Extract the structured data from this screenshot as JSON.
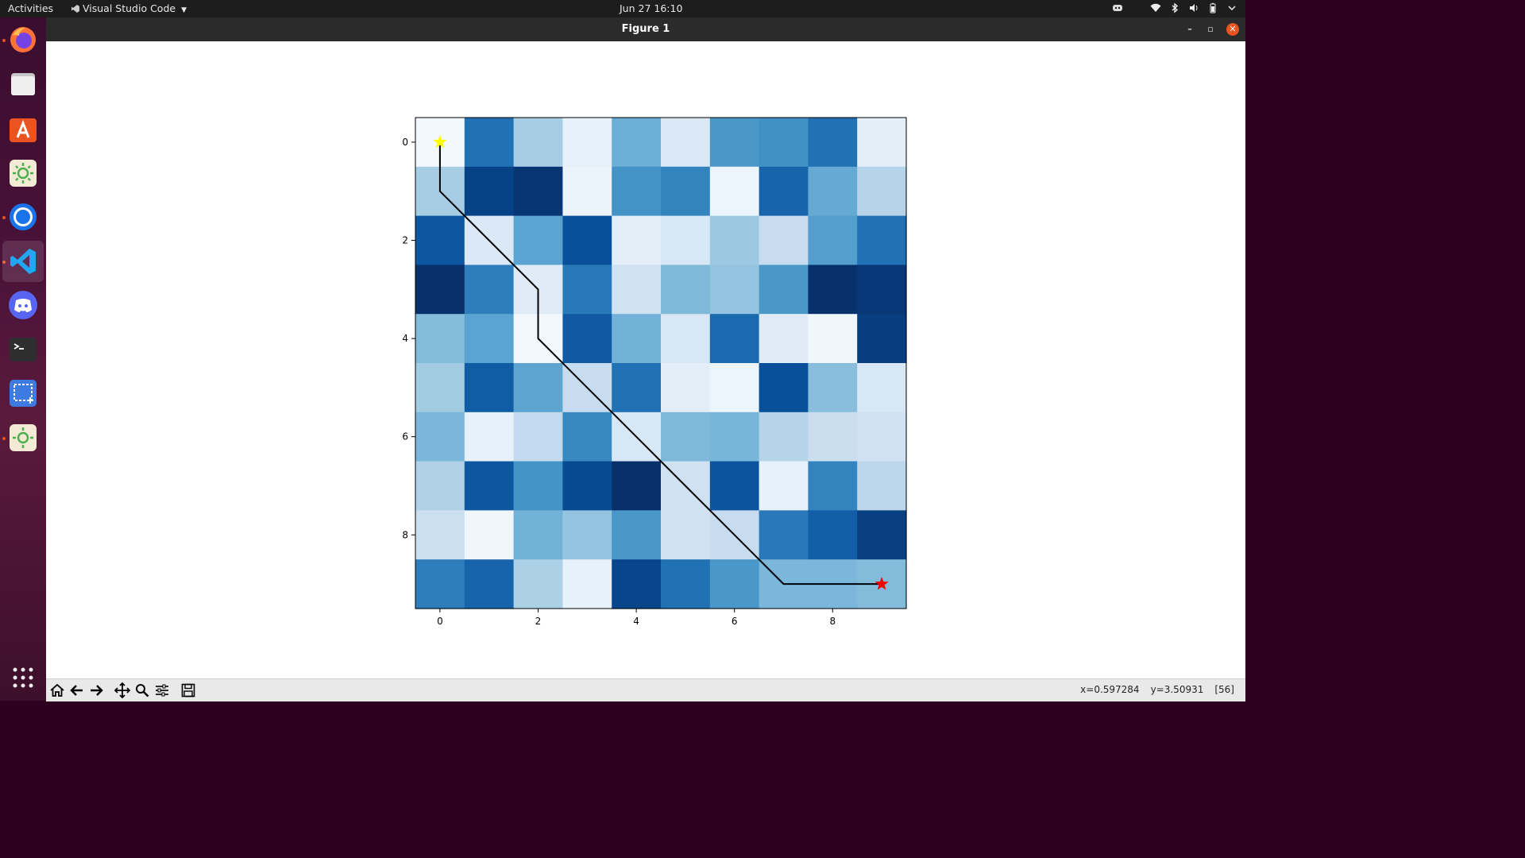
{
  "topbar": {
    "activities": "Activities",
    "app_name": "Visual Studio Code",
    "clock": "Jun 27  16:10"
  },
  "dock": {
    "items": [
      {
        "name": "firefox",
        "icon": "firefox-icon",
        "running": true
      },
      {
        "name": "files",
        "icon": "folder-icon",
        "running": false
      },
      {
        "name": "software",
        "icon": "app-store-icon",
        "running": false
      },
      {
        "name": "settings",
        "icon": "sun-settings-icon",
        "running": false
      },
      {
        "name": "chrome",
        "icon": "chrome-icon",
        "running": true
      },
      {
        "name": "vscode",
        "icon": "vscode-icon",
        "running": true,
        "active": true
      },
      {
        "name": "discord",
        "icon": "discord-icon",
        "running": false
      },
      {
        "name": "terminal",
        "icon": "terminal-icon",
        "running": false
      },
      {
        "name": "screenshot",
        "icon": "screenshot-icon",
        "running": false
      },
      {
        "name": "settings2",
        "icon": "sun-settings-icon",
        "running": true
      }
    ]
  },
  "window": {
    "title": "Figure 1",
    "coords": {
      "x": "x=0.597284",
      "y": "y=3.50931",
      "value": "[56]"
    }
  },
  "colors": {
    "accent": "#e95420",
    "start_marker": "#ffff00",
    "end_marker": "#ff0000",
    "path": "#000000"
  },
  "chart_data": {
    "type": "heatmap",
    "colormap": "Blues",
    "title": "",
    "xlabel": "",
    "ylabel": "",
    "xticks": [
      0,
      2,
      4,
      6,
      8
    ],
    "yticks": [
      0,
      2,
      4,
      6,
      8
    ],
    "xlim": [
      -0.5,
      9.5
    ],
    "ylim": [
      9.5,
      -0.5
    ],
    "grid": false,
    "values": [
      [
        2,
        75,
        35,
        8,
        50,
        14,
        60,
        63,
        75,
        10
      ],
      [
        35,
        93,
        98,
        6,
        62,
        68,
        5,
        80,
        52,
        30
      ],
      [
        85,
        14,
        55,
        88,
        10,
        16,
        38,
        24,
        57,
        75
      ],
      [
        100,
        70,
        12,
        72,
        20,
        45,
        40,
        60,
        100,
        97
      ],
      [
        44,
        55,
        3,
        84,
        48,
        16,
        78,
        12,
        4,
        95
      ],
      [
        36,
        83,
        54,
        24,
        75,
        10,
        5,
        88,
        43,
        16
      ],
      [
        46,
        8,
        26,
        66,
        16,
        45,
        47,
        30,
        23,
        20
      ],
      [
        32,
        85,
        62,
        90,
        100,
        20,
        86,
        8,
        68,
        28
      ],
      [
        22,
        4,
        48,
        40,
        60,
        20,
        24,
        72,
        82,
        94
      ],
      [
        70,
        80,
        33,
        8,
        92,
        75,
        60,
        46,
        46,
        44
      ]
    ],
    "path": [
      [
        0,
        0
      ],
      [
        0,
        1
      ],
      [
        1,
        2
      ],
      [
        2,
        3
      ],
      [
        2,
        4
      ],
      [
        3,
        5
      ],
      [
        4,
        6
      ],
      [
        5,
        7
      ],
      [
        6,
        8
      ],
      [
        7,
        9
      ],
      [
        8,
        9
      ],
      [
        9,
        9
      ]
    ],
    "start": [
      0,
      0
    ],
    "end": [
      9,
      9
    ]
  }
}
